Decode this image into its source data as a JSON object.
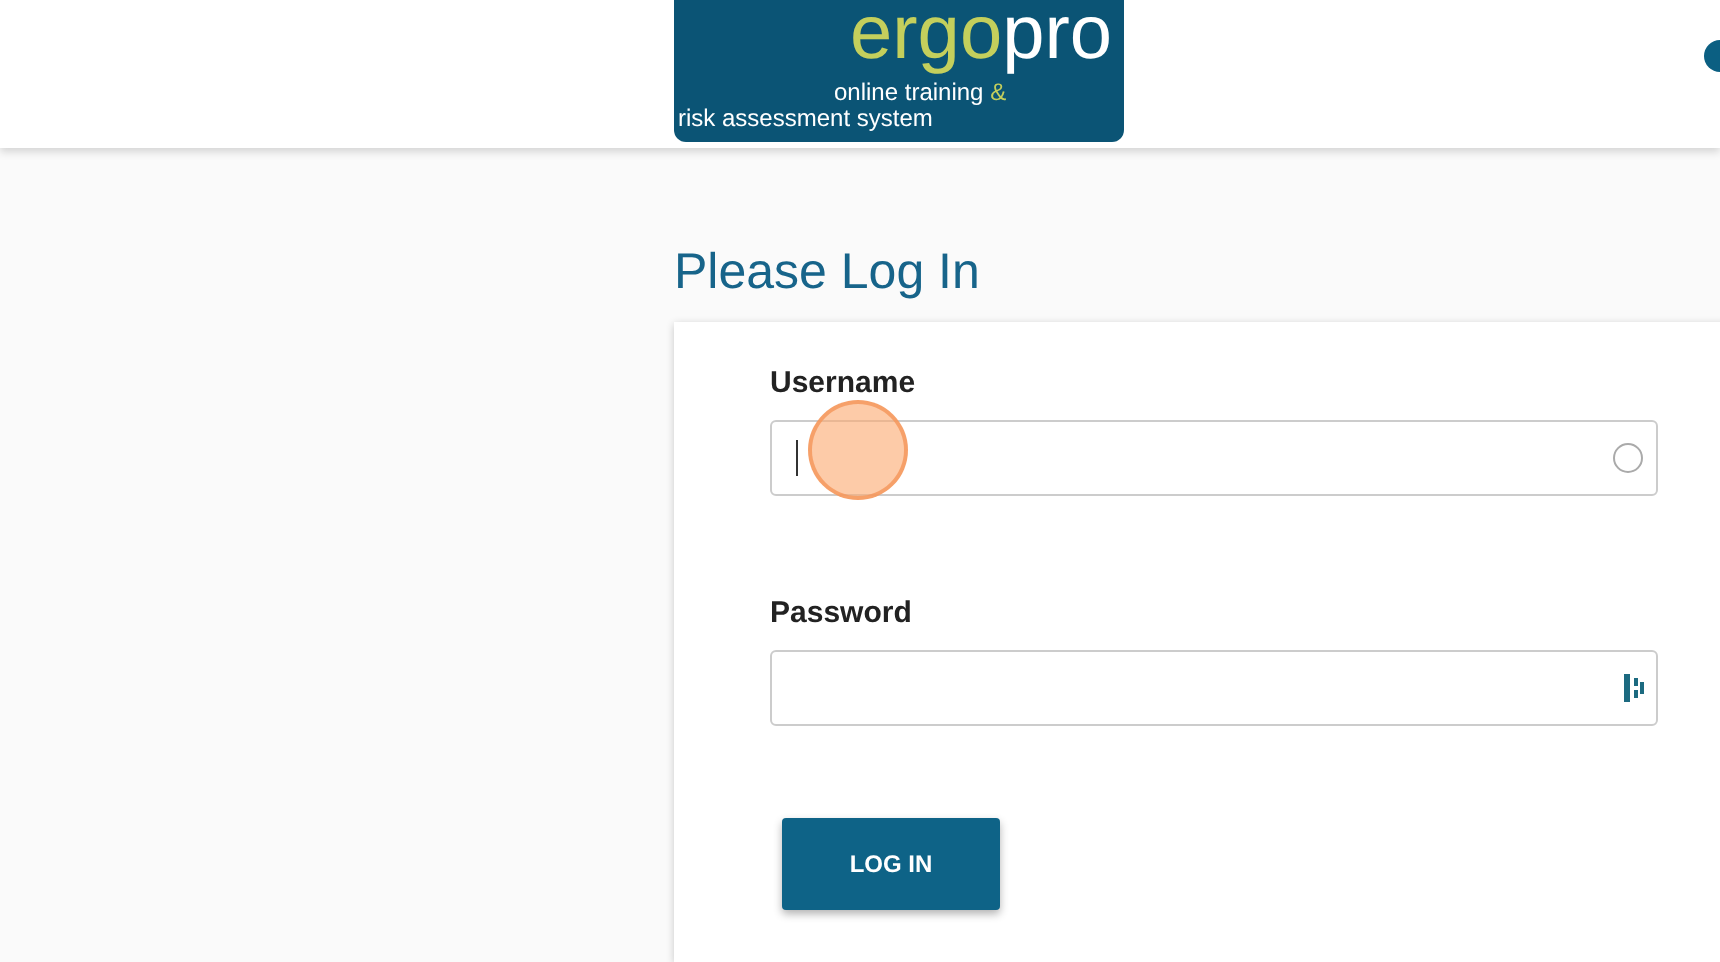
{
  "logo": {
    "word_1": "ergo",
    "word_2": "pro",
    "tagline_1": "online training ",
    "ampersand": "&",
    "tagline_2": "risk assessment system"
  },
  "title": "Please Log In",
  "fields": [
    {
      "label": "Username",
      "kind": "text",
      "focused": true
    },
    {
      "label": "Password",
      "kind": "password",
      "focused": false
    }
  ],
  "button": "LOG IN"
}
